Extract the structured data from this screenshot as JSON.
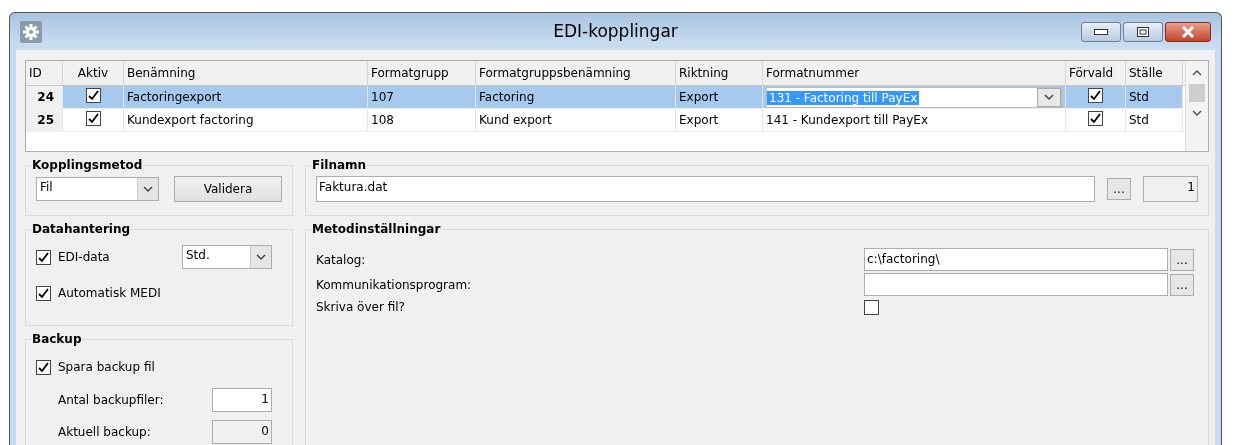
{
  "window": {
    "title": "EDI-kopplingar"
  },
  "grid": {
    "columns": [
      "ID",
      "Aktiv",
      "Benämning",
      "Formatgrupp",
      "Formatgruppsbenämning",
      "Riktning",
      "Formatnummer",
      "Förvald",
      "Ställe"
    ],
    "rows": [
      {
        "id": "24",
        "active": true,
        "name": "Factoringexport",
        "format_group": "107",
        "format_group_name": "Factoring",
        "direction": "Export",
        "format_number": "131 - Factoring till PayEx",
        "default": true,
        "place": "Std",
        "selected": true
      },
      {
        "id": "25",
        "active": true,
        "name": "Kundexport factoring",
        "format_group": "108",
        "format_group_name": "Kund export",
        "direction": "Export",
        "format_number": "141 - Kundexport till PayEx",
        "default": true,
        "place": "Std",
        "selected": false
      }
    ]
  },
  "connection_method": {
    "title": "Kopplingsmetod",
    "method": "Fil",
    "validate_button": "Validera"
  },
  "file_name": {
    "title": "Filnamn",
    "value": "Faktura.dat",
    "browse_button": "...",
    "counter": "1"
  },
  "data_handling": {
    "title": "Datahantering",
    "options": [
      {
        "label": "EDI-data",
        "checked": true,
        "dropdown": "Std."
      },
      {
        "label": "Automatisk MEDI",
        "checked": true
      }
    ]
  },
  "backup": {
    "title": "Backup",
    "save": {
      "label": "Spara backup fil",
      "checked": true
    },
    "fields": [
      {
        "label": "Antal backupfiler:",
        "value": "1",
        "disabled": false
      },
      {
        "label": "Aktuell backup:",
        "value": "0",
        "disabled": true
      }
    ]
  },
  "method_settings": {
    "title": "Metodinställningar",
    "settings": [
      {
        "kind": "path",
        "label": "Katalog:",
        "value": "c:\\factoring\\",
        "browse_button": "..."
      },
      {
        "kind": "path",
        "label": "Kommunikationsprogram:",
        "browse_button": "..."
      },
      {
        "kind": "checkbox",
        "label": "Skriva över fil?",
        "checked": false
      }
    ]
  }
}
